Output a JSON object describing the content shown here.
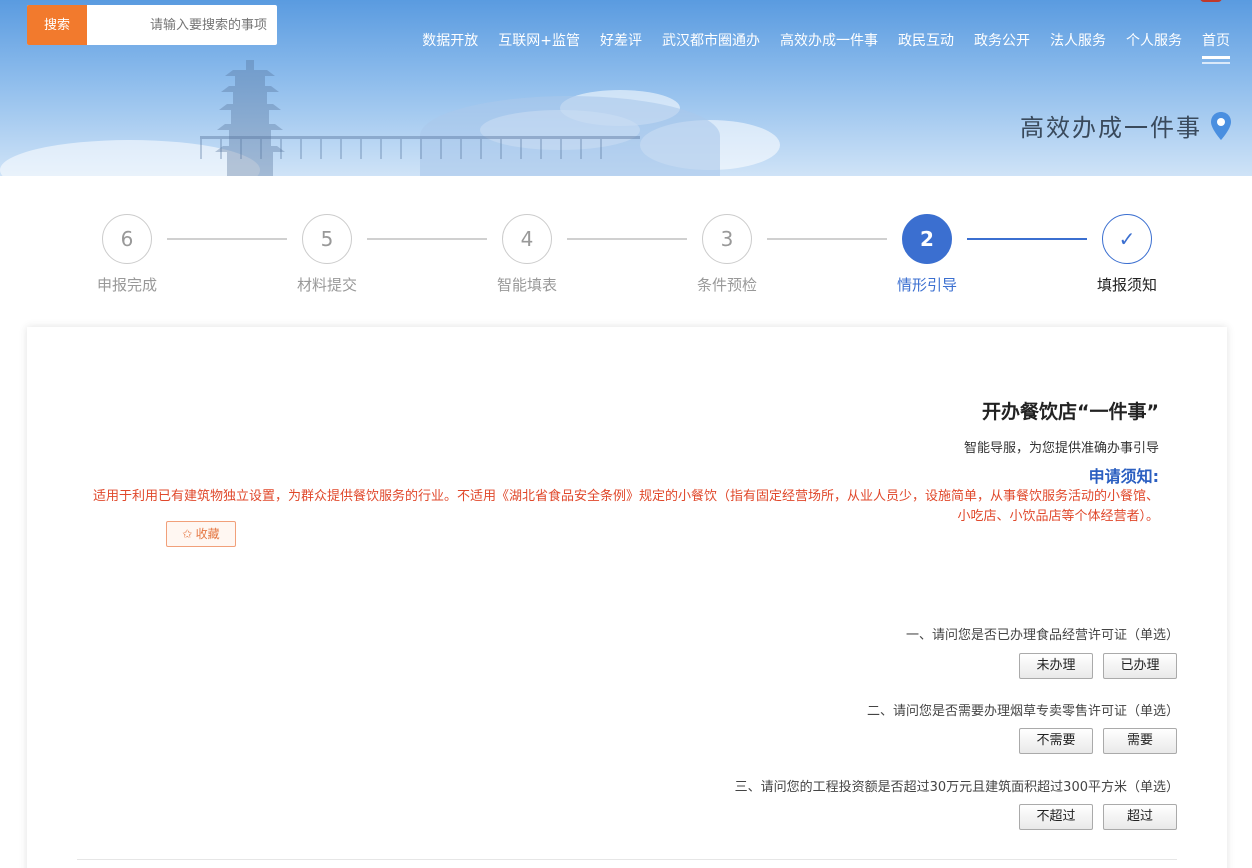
{
  "header": {
    "search_button": "搜索",
    "search_placeholder": "请输入要搜索的事项",
    "nav": [
      {
        "label": "首页",
        "active": true
      },
      {
        "label": "个人服务"
      },
      {
        "label": "法人服务"
      },
      {
        "label": "政务公开"
      },
      {
        "label": "政民互动"
      },
      {
        "label": "高效办成一件事"
      },
      {
        "label": "武汉都市圈通办"
      },
      {
        "label": "好差评"
      },
      {
        "label": "互联网+监管"
      },
      {
        "label": "数据开放"
      }
    ],
    "page_title": "高效办成一件事"
  },
  "steps": [
    {
      "num": "✓",
      "label": "填报须知",
      "state": "done"
    },
    {
      "num": "2",
      "label": "情形引导",
      "state": "current"
    },
    {
      "num": "3",
      "label": "条件预检",
      "state": "todo"
    },
    {
      "num": "4",
      "label": "智能填表",
      "state": "todo"
    },
    {
      "num": "5",
      "label": "材料提交",
      "state": "todo"
    },
    {
      "num": "6",
      "label": "申报完成",
      "state": "todo"
    }
  ],
  "card": {
    "title": "开办餐饮店“一件事”",
    "subtitle": "智能导服，为您提供准确办事引导",
    "notice_heading": "申请须知:",
    "notice_text": "适用于利用已有建筑物独立设置，为群众提供餐饮服务的行业。不适用《湖北省食品安全条例》规定的小餐饮（指有固定经营场所，从业人员少，设施简单，从事餐饮服务活动的小餐馆、小吃店、小饮品店等个体经营者）。",
    "collect_label": "✩ 收藏"
  },
  "questions": [
    {
      "text": "一、请问您是否已办理食品经营许可证（单选）",
      "options": [
        "已办理",
        "未办理"
      ]
    },
    {
      "text": "二、请问您是否需要办理烟草专卖零售许可证（单选）",
      "options": [
        "需要",
        "不需要"
      ]
    },
    {
      "text": "三、请问您的工程投资额是否超过30万元且建筑面积超过300平方米（单选）",
      "options": [
        "超过",
        "不超过"
      ]
    }
  ],
  "colors": {
    "accent": "#3b6fd0",
    "search": "#f27a2d",
    "notice": "#e0482b"
  }
}
